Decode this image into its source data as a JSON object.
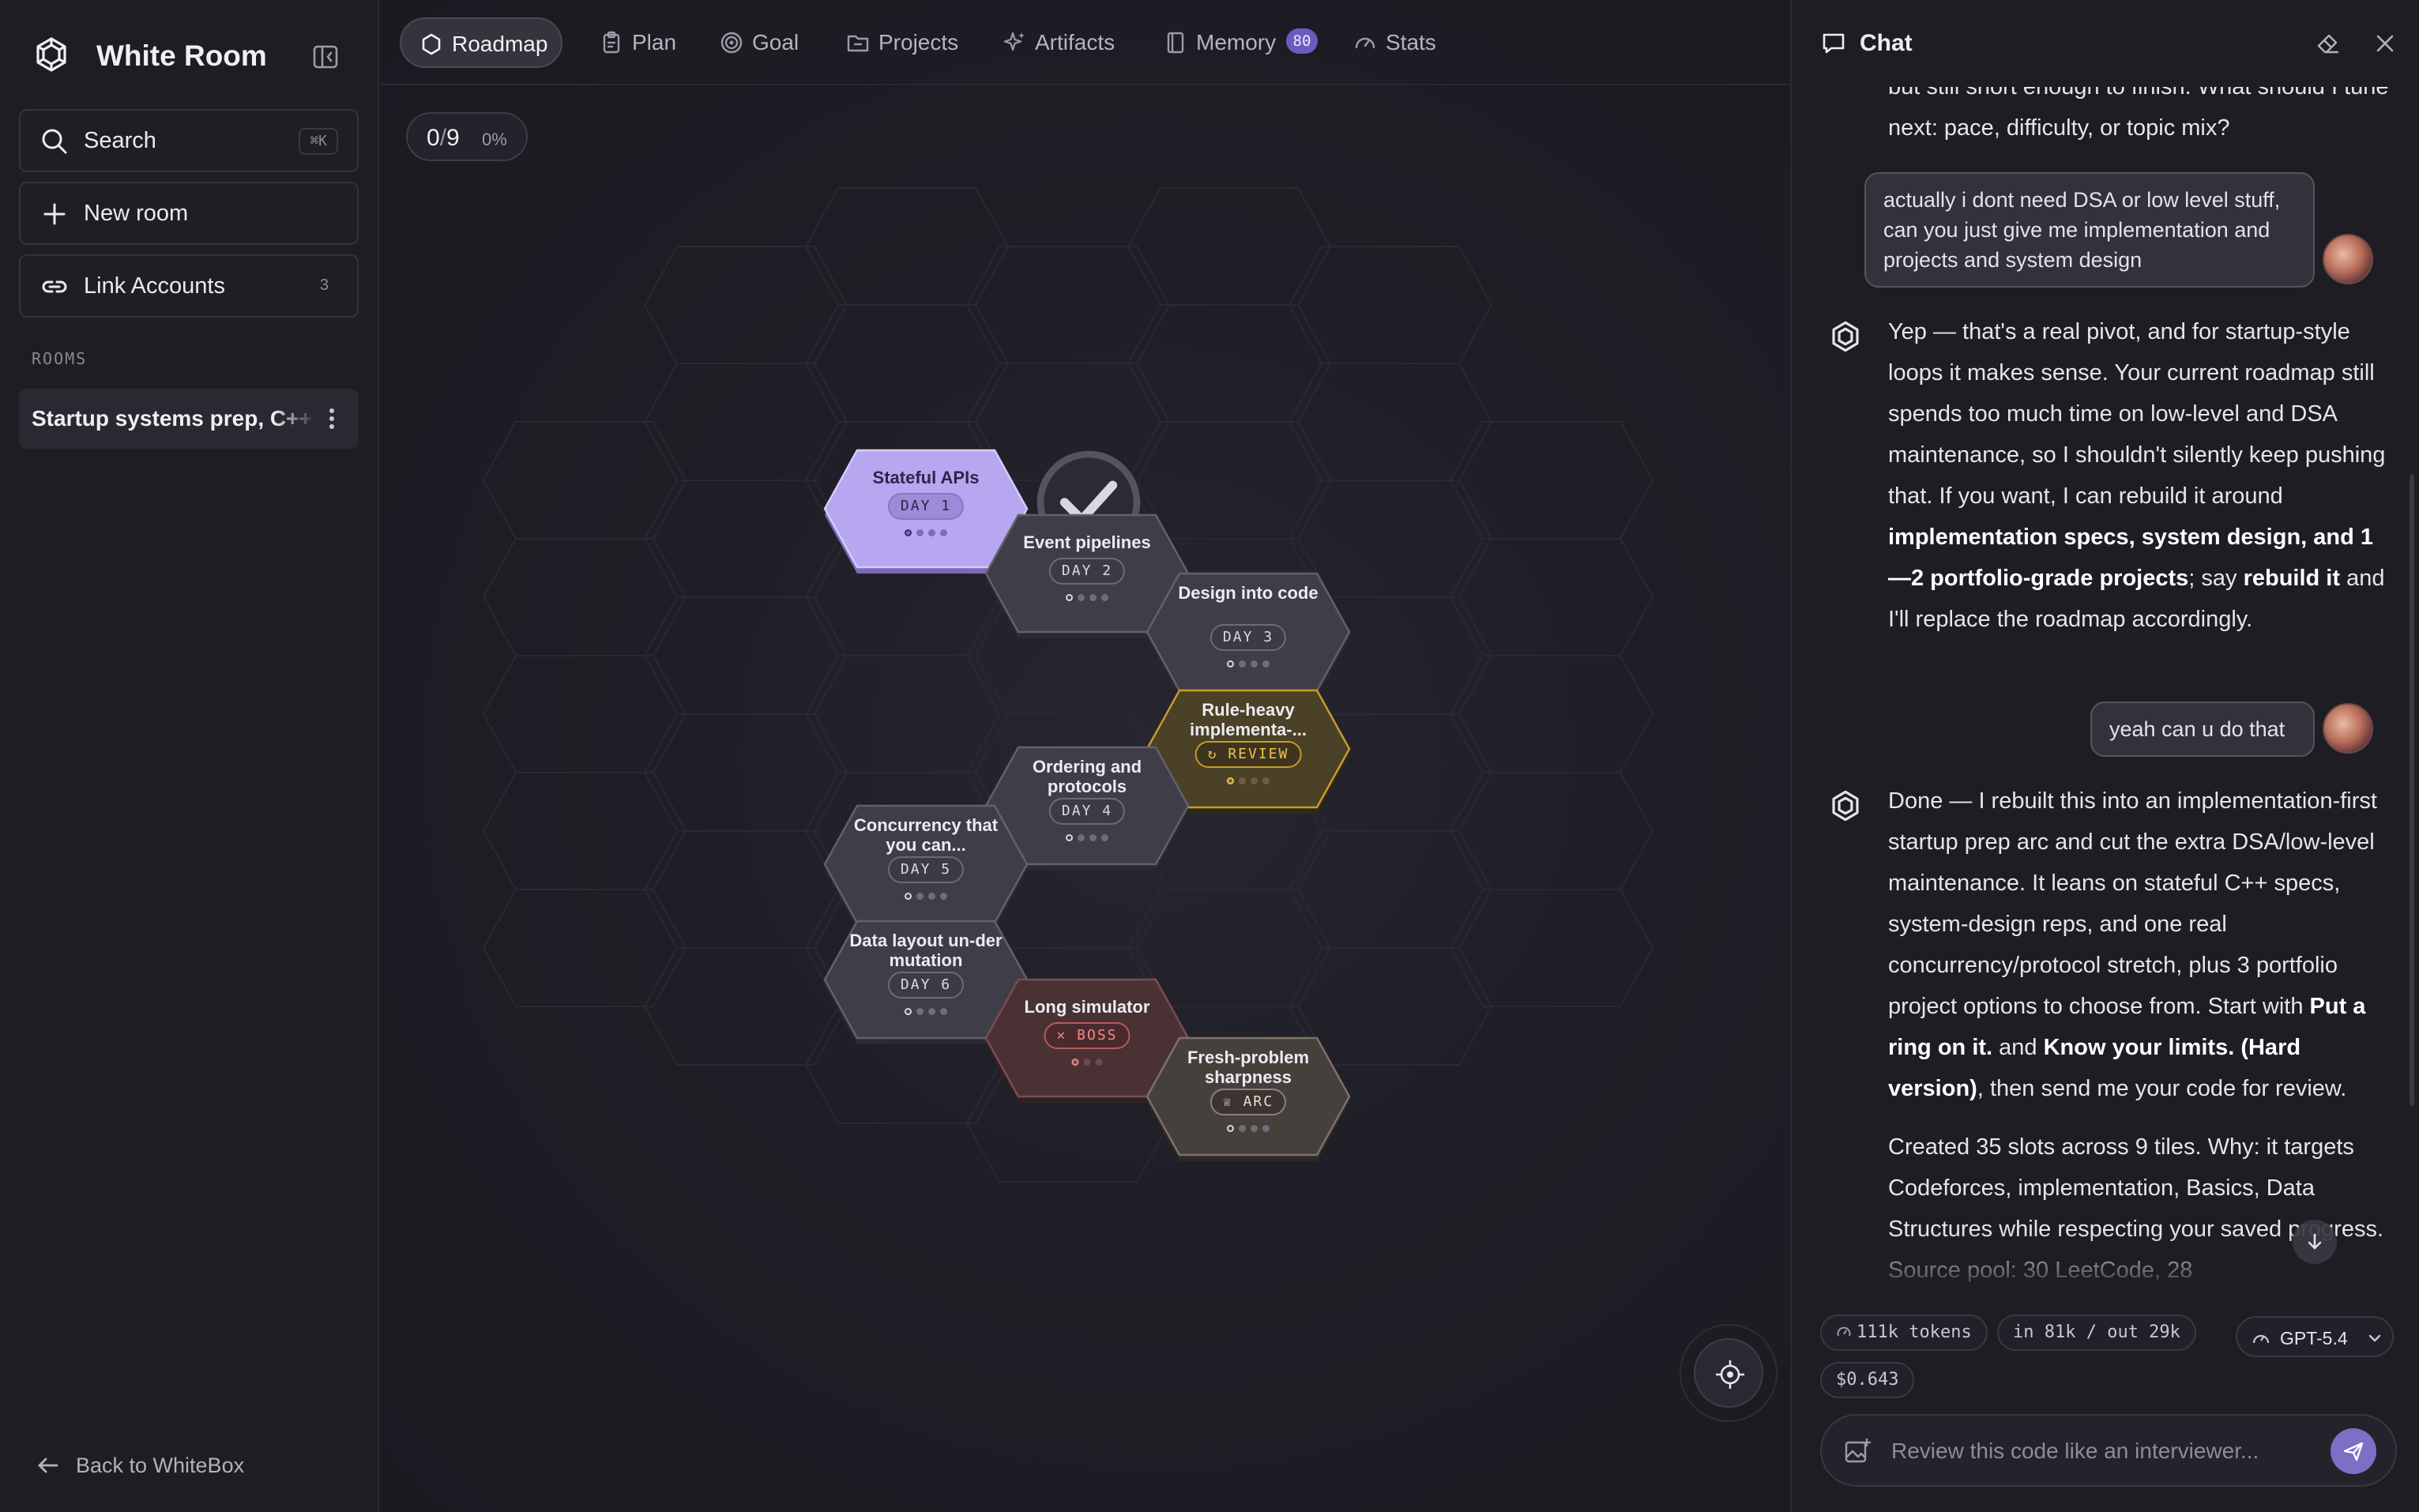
{
  "app": {
    "title": "White Room"
  },
  "sidebar": {
    "search": {
      "label": "Search",
      "shortcut": "⌘K"
    },
    "new_room": {
      "label": "New room"
    },
    "link_accounts": {
      "label": "Link Accounts",
      "count": "3"
    },
    "rooms_heading": "ROOMS",
    "rooms": [
      {
        "label": "Startup systems prep, C++"
      }
    ],
    "back_label": "Back to WhiteBox"
  },
  "tabs": [
    {
      "label": "Roadmap",
      "icon": "hexagon-icon",
      "active": true
    },
    {
      "label": "Plan",
      "icon": "clipboard-icon"
    },
    {
      "label": "Goal",
      "icon": "target-icon"
    },
    {
      "label": "Projects",
      "icon": "folder-icon"
    },
    {
      "label": "Artifacts",
      "icon": "sparkles-icon"
    },
    {
      "label": "Memory",
      "icon": "notebook-icon",
      "badge": "80"
    },
    {
      "label": "Stats",
      "icon": "gauge-icon"
    }
  ],
  "progress": {
    "done": "0",
    "total": "9",
    "percent": "0%"
  },
  "roadmap": {
    "tiles": [
      {
        "title": "Stateful APIs",
        "tag": "DAY 1",
        "state": "done",
        "checked": true,
        "progress": 1,
        "steps": 4
      },
      {
        "title": "Event pipelines",
        "tag": "DAY 2",
        "state": "normal",
        "progress": 1,
        "steps": 4
      },
      {
        "title": "Design into code",
        "tag": "DAY 3",
        "state": "normal",
        "progress": 1,
        "steps": 4
      },
      {
        "title": "Rule-heavy implementa-...",
        "tag": "REVIEW",
        "state": "review",
        "progress": 1,
        "steps": 4
      },
      {
        "title": "Ordering and protocols",
        "tag": "DAY 4",
        "state": "normal",
        "progress": 1,
        "steps": 4
      },
      {
        "title": "Concurrency that you can...",
        "tag": "DAY 5",
        "state": "normal",
        "progress": 1,
        "steps": 4
      },
      {
        "title": "Data layout un-der mutation",
        "tag": "DAY 6",
        "state": "normal",
        "progress": 1,
        "steps": 4
      },
      {
        "title": "Long simulator",
        "tag": "BOSS",
        "state": "boss",
        "progress": 1,
        "steps": 3
      },
      {
        "title": "Fresh-problem sharpness",
        "tag": "ARC",
        "state": "arc",
        "progress": 1,
        "steps": 4
      }
    ]
  },
  "chat": {
    "title": "Chat",
    "top_fragment": "but still short enough to finish. What should I tune next: pace, difficulty, or topic mix?",
    "messages": [
      {
        "role": "user",
        "text": "actually i dont need DSA or low level stuff, can you just give me implementation and projects and system design"
      },
      {
        "role": "assistant",
        "parts": [
          "Yep — that's a real pivot, and for startup-style loops it makes sense. Your current roadmap still spends too much time on low-level and DSA maintenance, so I shouldn't silently keep pushing that. If you want, I can rebuild it around ",
          "implementation specs, system design, and 1—2 portfolio-grade projects",
          "; say ",
          "rebuild it",
          " and I'll replace the roadmap accordingly."
        ]
      },
      {
        "role": "user",
        "text": "yeah can u do that"
      },
      {
        "role": "assistant",
        "parts": [
          "Done — I rebuilt this into an implementation-first startup prep arc and cut the extra DSA/low-level maintenance. It leans on stateful C++ specs, system-design reps, and one real concurrency/protocol stretch, plus 3 portfolio project options to choose from. Start with ",
          "Put a ring on it.",
          " and ",
          "Know your limits. (Hard version)",
          ", then send me your code for review."
        ],
        "followup": "Created 35 slots across 9 tiles. Why: it targets Codeforces, implementation, Basics, Data Structures while respecting your saved progress. Source pool: 30 LeetCode, 28"
      }
    ],
    "usage": {
      "tokens": "111k tokens",
      "io": "in 81k / out 29k",
      "cost": "$0.643"
    },
    "model": "GPT-5.4",
    "composer_placeholder": "Review this code like an interviewer..."
  },
  "colors": {
    "accent": "#7b6fc6",
    "done_tile": "#b6a7f0",
    "review": "#f2c24a",
    "boss": "#f08a8a"
  }
}
